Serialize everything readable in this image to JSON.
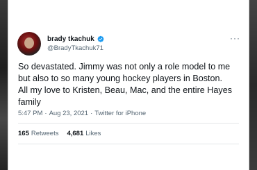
{
  "author": {
    "display_name": "brady tkachuk",
    "handle": "@BradyTkachuk71",
    "verified": true
  },
  "tweet": {
    "text": "So devastated. Jimmy was not only a role model to me\nbut also to so many young hockey players in Boston.\nAll my love to Kristen, Beau, Mac, and the entire Hayes\nfamily",
    "time": "5:47 PM",
    "separator1": "·",
    "date": "Aug 23, 2021",
    "separator2": "·",
    "source": "Twitter for iPhone"
  },
  "stats": {
    "retweets_count": "165",
    "retweets_label": "Retweets",
    "likes_count": "4,681",
    "likes_label": "Likes"
  },
  "colors": {
    "verified_blue": "#1d9bf0",
    "text_primary": "#0f1419",
    "text_secondary": "#536471"
  },
  "icons": {
    "more": "more-options-icon",
    "verified": "verified-badge-icon"
  }
}
